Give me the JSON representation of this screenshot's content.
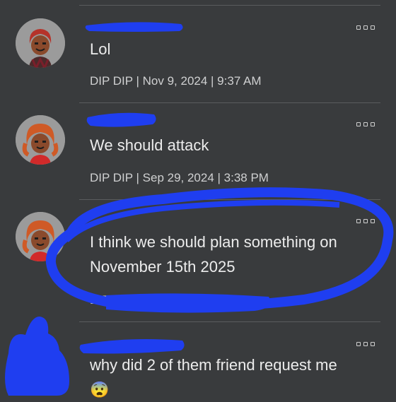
{
  "comments": [
    {
      "text": "Lol",
      "meta": "DIP DIP | Nov 9, 2024 | 9:37 AM"
    },
    {
      "text": "We should attack",
      "meta": "DIP DIP | Sep 29, 2024 | 3:38 PM"
    },
    {
      "text": "I think we should plan something on November 15th 2025",
      "meta": "DIP DIP"
    },
    {
      "text": "why did 2 of them friend request me",
      "emoji": "😨"
    }
  ],
  "colors": {
    "background": "#393b3d",
    "scribble": "#1f3ef0"
  }
}
